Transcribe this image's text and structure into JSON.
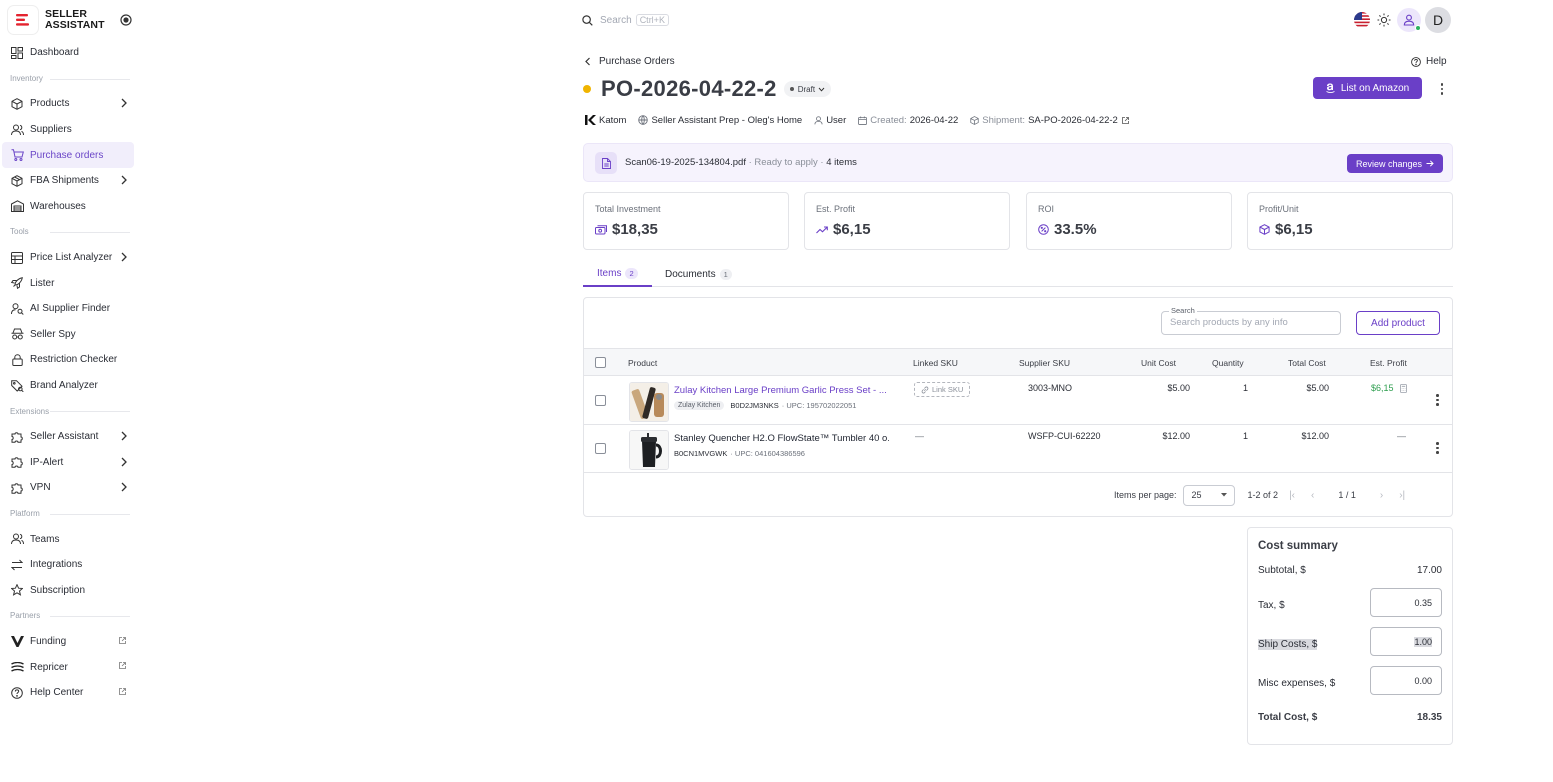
{
  "brand": {
    "name": "SELLER ASSISTANT"
  },
  "nav": {
    "dashboard": "Dashboard",
    "section_inventory": "Inventory",
    "products": "Products",
    "suppliers": "Suppliers",
    "purchase_orders": "Purchase orders",
    "fba_shipments": "FBA Shipments",
    "warehouses": "Warehouses",
    "section_tools": "Tools",
    "price_list_analyzer": "Price List Analyzer",
    "lister": "Lister",
    "ai_supplier_finder": "AI Supplier Finder",
    "seller_spy": "Seller Spy",
    "restriction_checker": "Restriction Checker",
    "brand_analyzer": "Brand Analyzer",
    "section_extensions": "Extensions",
    "seller_assistant": "Seller Assistant",
    "ip_alert": "IP-Alert",
    "vpn": "VPN",
    "section_platform": "Platform",
    "teams": "Teams",
    "integrations": "Integrations",
    "subscription": "Subscription",
    "section_partners": "Partners",
    "funding": "Funding",
    "repricer": "Repricer",
    "help_center": "Help Center"
  },
  "header": {
    "search_placeholder": "Search",
    "search_shortcut": "Ctrl+K",
    "avatar_letter": "D"
  },
  "page": {
    "breadcrumb": "Purchase Orders",
    "help": "Help",
    "title": "PO-2026-04-22-2",
    "status": "Draft",
    "list_button": "List on Amazon",
    "meta": {
      "supplier": "Katom",
      "warehouse": "Seller Assistant Prep - Oleg's Home",
      "user": "User",
      "created_label": "Created:",
      "created_value": "2026-04-22",
      "shipment_label": "Shipment:",
      "shipment_value": "SA-PO-2026-04-22-2"
    },
    "scan": {
      "file": "Scan06-19-2025-134804.pdf",
      "status": " · Ready to apply · ",
      "items": "4 items",
      "button": "Review changes"
    },
    "stats": [
      {
        "label": "Total Investment",
        "value": "$18,35"
      },
      {
        "label": "Est. Profit",
        "value": "$6,15"
      },
      {
        "label": "ROI",
        "value": "33.5%"
      },
      {
        "label": "Profit/Unit",
        "value": "$6,15"
      }
    ],
    "tabs": [
      {
        "label": "Items",
        "count": "2"
      },
      {
        "label": "Documents",
        "count": "1"
      }
    ]
  },
  "table": {
    "search_label": "Search",
    "search_placeholder": "Search products by any info",
    "add_button": "Add product",
    "columns": {
      "product": "Product",
      "linked_sku": "Linked SKU",
      "supplier_sku": "Supplier SKU",
      "unit_cost": "Unit Cost",
      "quantity": "Quantity",
      "total_cost": "Total Cost",
      "est_profit": "Est. Profit"
    },
    "rows": [
      {
        "name": "Zulay Kitchen Large Premium Garlic Press Set - ...",
        "brand": "Zulay Kitchen",
        "asin": "B0D2JM3NKS",
        "upc": "· UPC: 195702022051",
        "linked_sku": "Link SKU",
        "supplier_sku": "3003-MNO",
        "unit_cost": "$5.00",
        "quantity": "1",
        "total_cost": "$5.00",
        "est_profit": "$6,15"
      },
      {
        "name": "Stanley Quencher H2.O FlowState™ Tumbler 40 o...",
        "brand": "",
        "asin": "B0CN1MVGWK",
        "upc": "· UPC: 041604386596",
        "linked_sku": "—",
        "supplier_sku": "WSFP-CUI-62220",
        "unit_cost": "$12.00",
        "quantity": "1",
        "total_cost": "$12.00",
        "est_profit": "—"
      }
    ],
    "pager": {
      "items_per_page_label": "Items per page:",
      "items_per_page": "25",
      "range": "1-2 of 2",
      "page": "1 / 1"
    }
  },
  "cost_summary": {
    "title": "Cost summary",
    "subtotal_label": "Subtotal, $",
    "subtotal": "17.00",
    "tax_label": "Tax, $",
    "tax": "0.35",
    "ship_label": "Ship Costs, $",
    "ship": "1.00",
    "misc_label": "Misc expenses, $",
    "misc": "0.00",
    "total_label": "Total Cost, $",
    "total": "18.35"
  },
  "colors": {
    "accent": "#6a3fc7",
    "draft": "#f0b400",
    "profit": "#2e9e4f"
  }
}
